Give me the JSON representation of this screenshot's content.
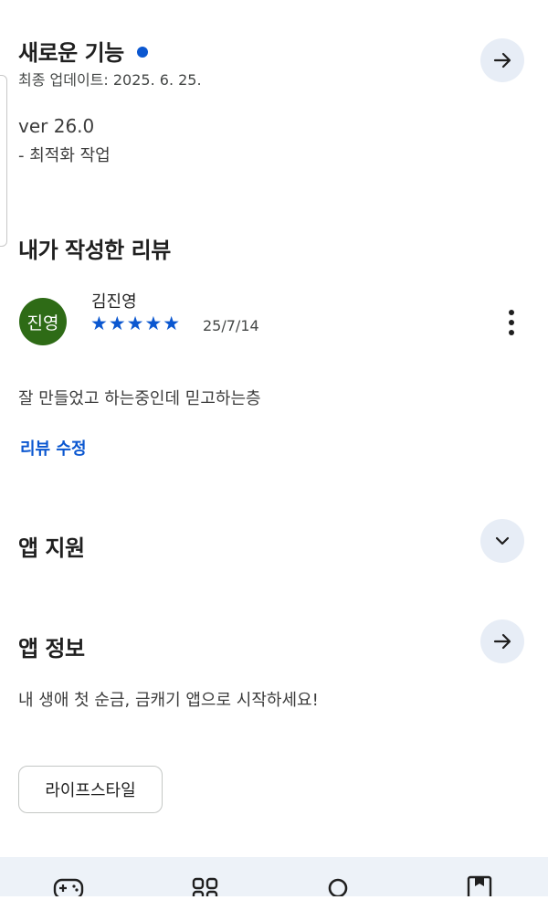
{
  "whats_new": {
    "title": "새로운 기능",
    "updated": "최종 업데이트: 2025. 6. 25.",
    "version": "ver 26.0",
    "note": "- 최적화 작업"
  },
  "my_review": {
    "title": "내가 작성한 리뷰",
    "avatar_text": "진영",
    "author": "김진영",
    "stars": "★★★★★",
    "rating": 5,
    "date": "25/7/14",
    "body": "잘 만들었고 하는중인데 믿고하는층",
    "edit_label": "리뷰 수정"
  },
  "app_support": {
    "title": "앱 지원"
  },
  "app_info": {
    "title": "앱 정보",
    "description": "내 생애 첫 순금, 금캐기 앱으로 시작하세요!",
    "category_chip": "라이프스타일"
  },
  "colors": {
    "accent": "#0b57d0",
    "avatar_bg": "#2e6b16",
    "button_bg": "#e7edf6",
    "nav_bg": "#edf2f8"
  },
  "bottom_nav": {
    "items": [
      "games-icon",
      "apps-icon",
      "search-icon",
      "books-icon"
    ]
  }
}
